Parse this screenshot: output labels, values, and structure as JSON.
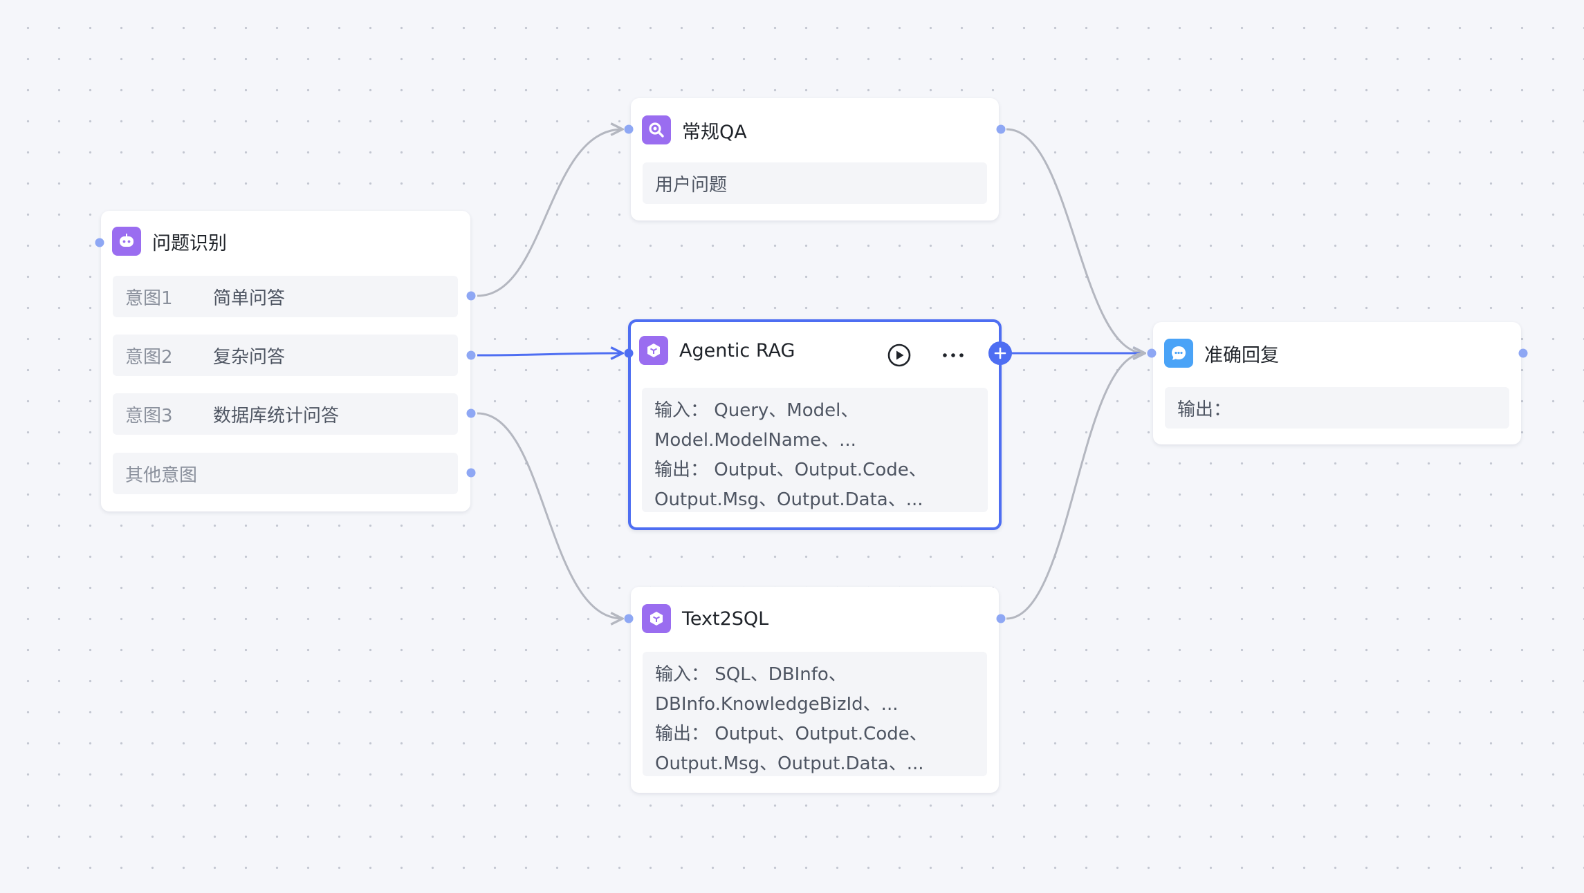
{
  "nodes": {
    "intent": {
      "title": "问题识别",
      "icon": "robot-icon",
      "rows": [
        {
          "key": "意图1",
          "value": "简单问答"
        },
        {
          "key": "意图2",
          "value": "复杂问答"
        },
        {
          "key": "意图3",
          "value": "数据库统计问答"
        },
        {
          "key": "其他意图",
          "value": ""
        }
      ]
    },
    "qa": {
      "title": "常规QA",
      "icon": "search-chat-icon",
      "field": "用户问题"
    },
    "rag": {
      "title": "Agentic RAG",
      "icon": "cube-icon",
      "lines": [
        "输入： Query、Model、",
        "Model.ModelName、...",
        "输出： Output、Output.Code、",
        "Output.Msg、Output.Data、..."
      ]
    },
    "sql": {
      "title": "Text2SQL",
      "icon": "cube-icon",
      "lines": [
        "输入： SQL、DBInfo、",
        "DBInfo.KnowledgeBizId、...",
        "输出： Output、Output.Code、",
        "Output.Msg、Output.Data、..."
      ]
    },
    "reply": {
      "title": "准确回复",
      "icon": "chat-bubble-icon",
      "field": "输出："
    }
  },
  "colors": {
    "accent": "#4e6ef2",
    "edge": "#b4b7c0",
    "node_icon": "#9a6df0",
    "reply_icon": "#4aa3f7",
    "port": "#8ea7f4"
  }
}
